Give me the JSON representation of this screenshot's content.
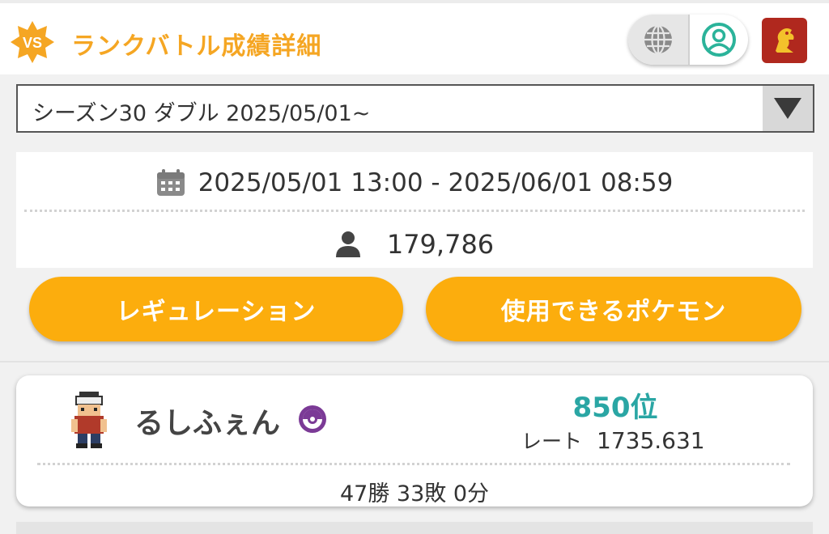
{
  "header": {
    "title": "ランクバトル成績詳細",
    "vs_badge_text": "VS",
    "language_icon": "globe-icon",
    "account_icon": "user-circle-icon",
    "crest_icon": "crest-icon"
  },
  "season_select": {
    "value": "シーズン30 ダブル 2025/05/01~",
    "arrow_icon": "caret-down-icon"
  },
  "season_info": {
    "period": "2025/05/01 13:00 - 2025/06/01 08:59",
    "players": "179,786",
    "calendar_icon": "calendar-icon",
    "person_icon": "person-icon"
  },
  "buttons": {
    "regulation": "レギュレーション",
    "usable_pokemon": "使用できるポケモン"
  },
  "player": {
    "name": "るしふぇん",
    "rank": "850位",
    "rate_label": "レート",
    "rate_value": "1735.631",
    "record": "47勝 33敗 0分",
    "ball_icon": "pokeball-icon",
    "avatar_icon": "trainer-sprite-icon"
  },
  "colors": {
    "accent_orange": "#f5a623",
    "button_orange": "#fcad0d",
    "rank_teal": "#2aa6a4",
    "account_teal": "#2bb39a",
    "ball_purple": "#7b3a96"
  }
}
